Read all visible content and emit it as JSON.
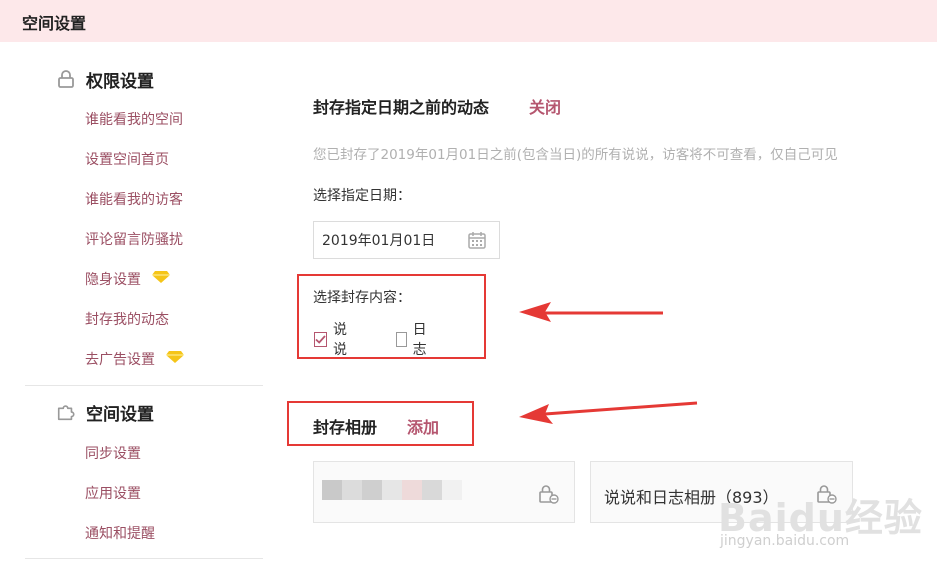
{
  "header": {
    "title": "空间设置"
  },
  "sidebar": {
    "sections": [
      {
        "title": "权限设置",
        "icon": "lock-icon",
        "items": [
          {
            "label": "谁能看我的空间",
            "vip": false
          },
          {
            "label": "设置空间首页",
            "vip": false
          },
          {
            "label": "谁能看我的访客",
            "vip": false
          },
          {
            "label": "评论留言防骚扰",
            "vip": false
          },
          {
            "label": "隐身设置",
            "vip": true
          },
          {
            "label": "封存我的动态",
            "vip": false
          },
          {
            "label": "去广告设置",
            "vip": true
          }
        ]
      },
      {
        "title": "空间设置",
        "icon": "puzzle-icon",
        "items": [
          {
            "label": "同步设置"
          },
          {
            "label": "应用设置"
          },
          {
            "label": "通知和提醒"
          }
        ]
      }
    ]
  },
  "archive": {
    "title": "封存指定日期之前的动态",
    "close_link": "关闭",
    "hint": "您已封存了2019年01月01日之前(包含当日)的所有说说，访客将不可查看，仅自己可见",
    "date_label": "选择指定日期：",
    "date_value": "2019年01月01日",
    "content_label": "选择封存内容：",
    "options": [
      {
        "label": "说说",
        "checked": true
      },
      {
        "label": "日志",
        "checked": false
      }
    ]
  },
  "albums": {
    "title": "封存相册",
    "add_link": "添加",
    "items": [
      {
        "name": ""
      },
      {
        "name": "说说和日志相册（893）"
      }
    ]
  },
  "watermark": {
    "brand": "Baidu经验",
    "url": "jingyan.baidu.com"
  },
  "colors": {
    "accent": "#b5566f",
    "header_bg": "#fde8ea",
    "annotation": "#e53935",
    "gem": "#f5c518"
  }
}
